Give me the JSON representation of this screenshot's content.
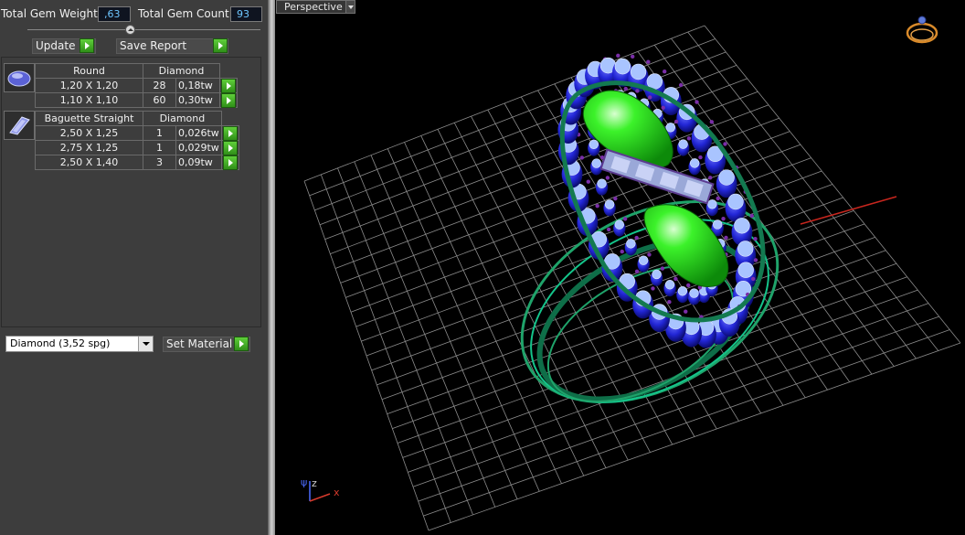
{
  "summary": {
    "total_weight_label": "Total Gem Weight",
    "total_weight_value": ",63",
    "total_count_label": "Total Gem Count",
    "total_count_value": "93"
  },
  "actions": {
    "update_label": "Update",
    "save_report_label": "Save Report",
    "set_material_label": "Set Material"
  },
  "gem_groups": [
    {
      "shape": "Round",
      "material": "Diamond",
      "rows": [
        {
          "size": "1,20 X 1,20",
          "count": "28",
          "weight": "0,18tw"
        },
        {
          "size": "1,10 X 1,10",
          "count": "60",
          "weight": "0,30tw"
        }
      ]
    },
    {
      "shape": "Baguette Straight",
      "material": "Diamond",
      "rows": [
        {
          "size": "2,50 X 1,25",
          "count": "1",
          "weight": "0,026tw"
        },
        {
          "size": "2,75 X 1,25",
          "count": "1",
          "weight": "0,029tw"
        },
        {
          "size": "2,50 X 1,40",
          "count": "3",
          "weight": "0,09tw"
        }
      ]
    }
  ],
  "material_select": {
    "value": "Diamond     (3,52 spg)"
  },
  "viewport": {
    "view_name": "Perspective",
    "axis_z": "z",
    "axis_x": "x"
  },
  "colors": {
    "panel_bg": "#3d3d3d",
    "go_green": "#3fae22",
    "gem_blue": "#1f20d8",
    "metal_green": "#1fa36a",
    "center_stone_green": "#2ee81a",
    "grid": "#9a9a9a",
    "axis_red": "#c8261e"
  },
  "icons": [
    "slider-knob-icon",
    "round-gem-icon",
    "baguette-gem-icon",
    "go-arrow-icon",
    "ring-nav-icon",
    "axis-gizmo-icon"
  ]
}
